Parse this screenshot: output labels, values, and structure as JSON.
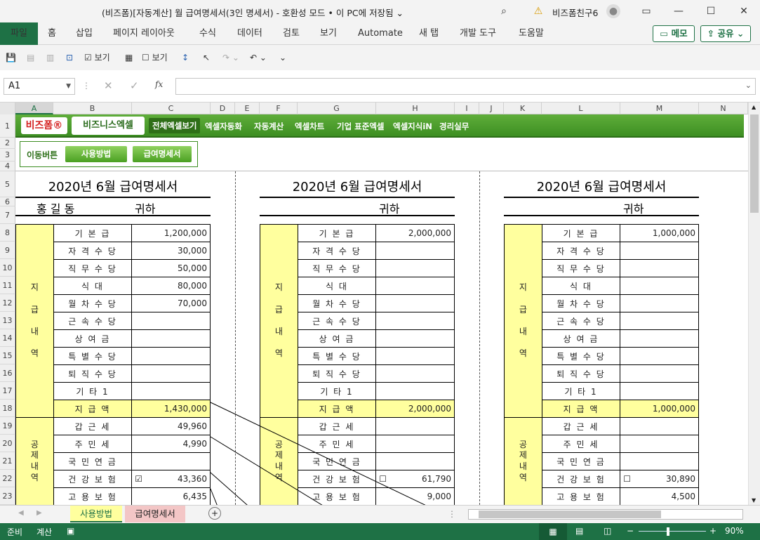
{
  "window": {
    "title": "(비즈폼)[자동계산] 월 급여명세서(3인 명세서)  -  호환성 모드 • 이 PC에 저장됨 ⌄",
    "account": "비즈폼친구6"
  },
  "ribbon": {
    "tabs": [
      "파일",
      "홈",
      "삽입",
      "페이지 레이아웃",
      "수식",
      "데이터",
      "검토",
      "보기",
      "Automate",
      "새 탭",
      "개발 도구",
      "도움말"
    ],
    "memo": "메모",
    "share": "공유"
  },
  "qat": {
    "view1": "보기",
    "view2": "보기"
  },
  "formula_bar": {
    "namebox": "A1",
    "fx": "fx",
    "value": ""
  },
  "columns": [
    "A",
    "B",
    "C",
    "D",
    "E",
    "F",
    "G",
    "H",
    "I",
    "J",
    "K",
    "L",
    "M",
    "N"
  ],
  "rows": [
    "1",
    "2",
    "3",
    "4",
    "5",
    "6",
    "7",
    "8",
    "9",
    "10",
    "11",
    "12",
    "13",
    "14",
    "15",
    "16",
    "17",
    "18",
    "19",
    "20",
    "21",
    "22",
    "23"
  ],
  "menu": {
    "logo1": "비즈폼®",
    "logo2": "비즈니스엑셀",
    "items": [
      "전체엑셀보기",
      "엑셀자동화",
      "자동계산",
      "엑셀차트",
      "기업 표준엑셀",
      "엑셀지식iN",
      "경리실무"
    ]
  },
  "move": {
    "label": "이동버튼",
    "btn1": "사용방법",
    "btn2": "급여명세서"
  },
  "sheets": [
    {
      "title": "2020년 6월 급여명세서",
      "name": "홍    길    동",
      "honor": "귀하",
      "pay": [
        "1,200,000",
        "30,000",
        "50,000",
        "80,000",
        "70,000",
        "",
        "",
        "",
        "",
        ""
      ],
      "total": "1,430,000",
      "ded": [
        "49,960",
        "4,990",
        "",
        "43,360",
        "6,435"
      ],
      "check": "☑"
    },
    {
      "title": "2020년 6월 급여명세서",
      "name": "",
      "honor": "귀하",
      "pay": [
        "2,000,000",
        "",
        "",
        "",
        "",
        "",
        "",
        "",
        "",
        ""
      ],
      "total": "2,000,000",
      "ded": [
        "",
        "",
        "",
        "61,790",
        "9,000"
      ],
      "check": "☐"
    },
    {
      "title": "2020년 6월 급여명세서",
      "name": "",
      "honor": "귀하",
      "pay": [
        "1,000,000",
        "",
        "",
        "",
        "",
        "",
        "",
        "",
        "",
        ""
      ],
      "total": "1,000,000",
      "ded": [
        "",
        "",
        "",
        "30,890",
        "4,500"
      ],
      "check": "☐"
    }
  ],
  "labels": {
    "pay": [
      "기 본 급",
      "자 격 수 당",
      "직 무 수 당",
      "식 대",
      "월 차 수 당",
      "근 속 수 당",
      "상 여 금",
      "특 별 수 당",
      "퇴 직 수 당",
      "기 타 1"
    ],
    "total": "지 급 액",
    "ded": [
      "갑 근 세",
      "주 민 세",
      "국 민 연 금",
      "건 강 보 험",
      "고 용 보 험"
    ],
    "cat1": "지\n\n급\n\n내\n\n역",
    "cat2": "공\n제\n내\n역"
  },
  "sheet_tabs": [
    "사용방법",
    "급여명세서"
  ],
  "status": {
    "ready": "준비",
    "calc": "계산",
    "zoom": "90%"
  }
}
